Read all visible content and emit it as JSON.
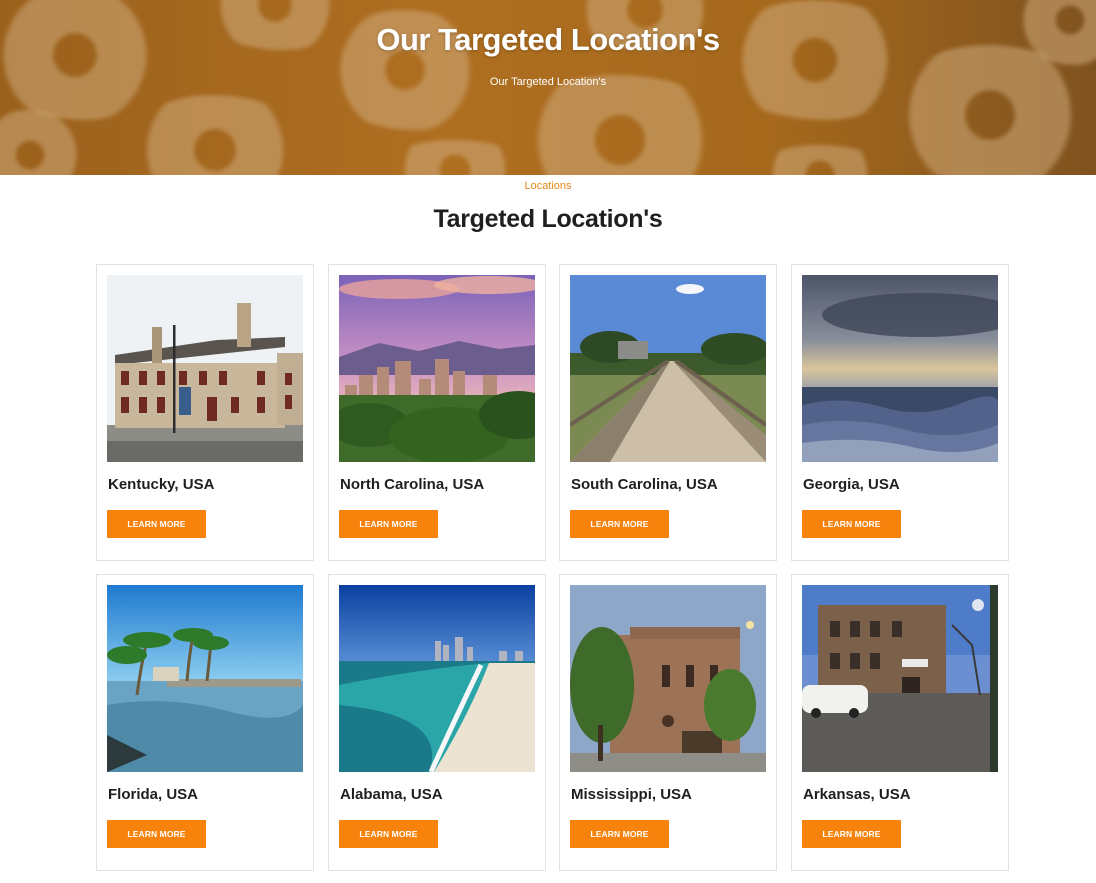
{
  "hero": {
    "title": "Our Targeted Location's",
    "subtitle": "Our Targeted Location's"
  },
  "breadcrumb": {
    "label": "Locations"
  },
  "section": {
    "title": "Targeted Location's"
  },
  "colors": {
    "accent": "#f7820c",
    "breadcrumb": "#e08a1a"
  },
  "locations": [
    {
      "name": "Kentucky, USA",
      "button": "LEARN MORE"
    },
    {
      "name": "North Carolina, USA",
      "button": "LEARN MORE"
    },
    {
      "name": "South Carolina, USA",
      "button": "LEARN MORE"
    },
    {
      "name": "Georgia, USA",
      "button": "LEARN MORE"
    },
    {
      "name": "Florida, USA",
      "button": "LEARN MORE"
    },
    {
      "name": "Alabama, USA",
      "button": "LEARN MORE"
    },
    {
      "name": "Mississippi, USA",
      "button": "LEARN MORE"
    },
    {
      "name": "Arkansas, USA",
      "button": "LEARN MORE"
    }
  ]
}
